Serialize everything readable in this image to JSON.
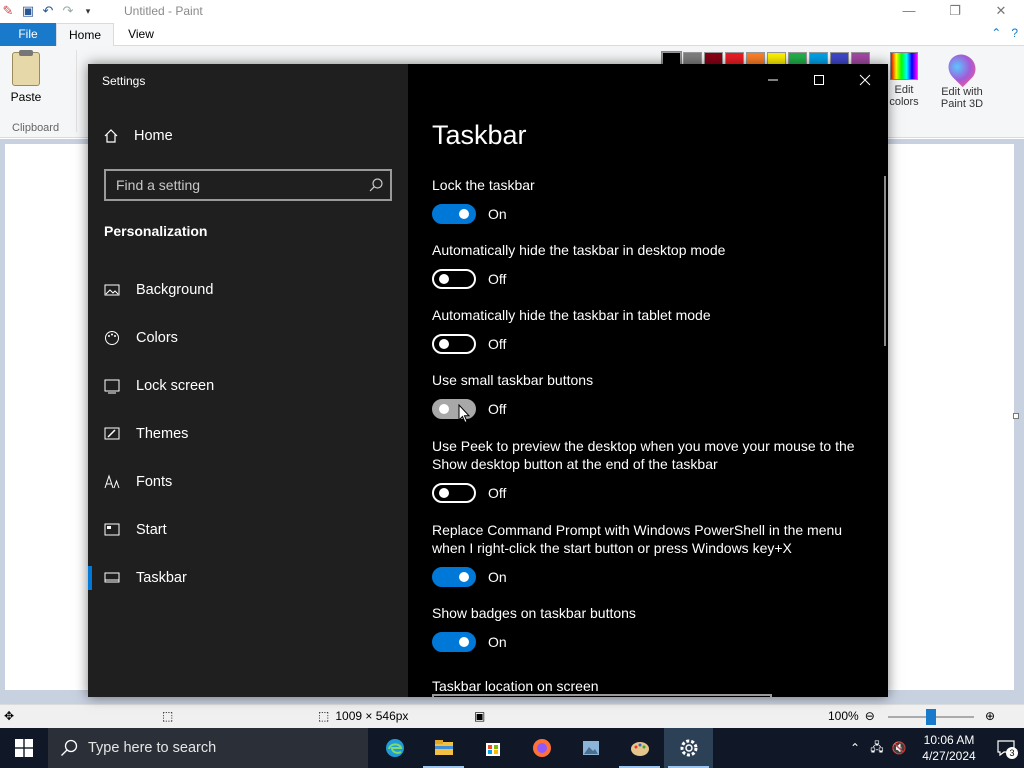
{
  "paint": {
    "title": "Untitled - Paint",
    "tabs": {
      "file": "File",
      "home": "Home",
      "view": "View"
    },
    "ribbon": {
      "paste": "Paste",
      "clipboard": "Clipboard",
      "edit_colors": "Edit colors",
      "edit_paint3d": "Edit with Paint 3D"
    },
    "palette": [
      "#000000",
      "#7f7f7f",
      "#880015",
      "#ed1c24",
      "#ff7f27",
      "#fff200",
      "#22b14c",
      "#00a2e8",
      "#3f48cc",
      "#a349a4"
    ],
    "status": {
      "size": "1009 × 546px",
      "zoom": "100%"
    },
    "zoom_fraction": 0.5
  },
  "settings": {
    "window_title": "Settings",
    "home": "Home",
    "search_placeholder": "Find a setting",
    "section": "Personalization",
    "nav": [
      {
        "label": "Background",
        "icon": "picture-icon"
      },
      {
        "label": "Colors",
        "icon": "palette-icon"
      },
      {
        "label": "Lock screen",
        "icon": "lock-screen-icon"
      },
      {
        "label": "Themes",
        "icon": "brush-icon"
      },
      {
        "label": "Fonts",
        "icon": "font-icon"
      },
      {
        "label": "Start",
        "icon": "start-grid-icon"
      },
      {
        "label": "Taskbar",
        "icon": "taskbar-icon",
        "active": true
      }
    ],
    "page_title": "Taskbar",
    "options": [
      {
        "label": "Lock the taskbar",
        "on": true,
        "state": "On"
      },
      {
        "label": "Automatically hide the taskbar in desktop mode",
        "on": false,
        "state": "Off"
      },
      {
        "label": "Automatically hide the taskbar in tablet mode",
        "on": false,
        "state": "Off"
      },
      {
        "label": "Use small taskbar buttons",
        "on": false,
        "state": "Off",
        "hover": true
      },
      {
        "label": "Use Peek to preview the desktop when you move your mouse to the Show desktop button at the end of the taskbar",
        "on": false,
        "state": "Off"
      },
      {
        "label": "Replace Command Prompt with Windows PowerShell in the menu when I right-click the start button or press Windows key+X",
        "on": true,
        "state": "On"
      },
      {
        "label": "Show badges on taskbar buttons",
        "on": true,
        "state": "On"
      }
    ],
    "location_label": "Taskbar location on screen"
  },
  "taskbar": {
    "search_placeholder": "Type here to search",
    "apps": [
      {
        "name": "edge-icon",
        "color": "#1f9cd8"
      },
      {
        "name": "file-explorer-icon",
        "color": "#f2c143"
      },
      {
        "name": "store-icon",
        "color": "#ffffff"
      },
      {
        "name": "firefox-icon",
        "color": "#ff7139"
      },
      {
        "name": "photos-icon",
        "color": "#8ab4d8"
      },
      {
        "name": "paint-icon",
        "color": "#e6c58a"
      },
      {
        "name": "settings-gear-icon",
        "color": "#ffffff"
      }
    ],
    "time": "10:06 AM",
    "date": "4/27/2024",
    "notification_count": "3"
  }
}
